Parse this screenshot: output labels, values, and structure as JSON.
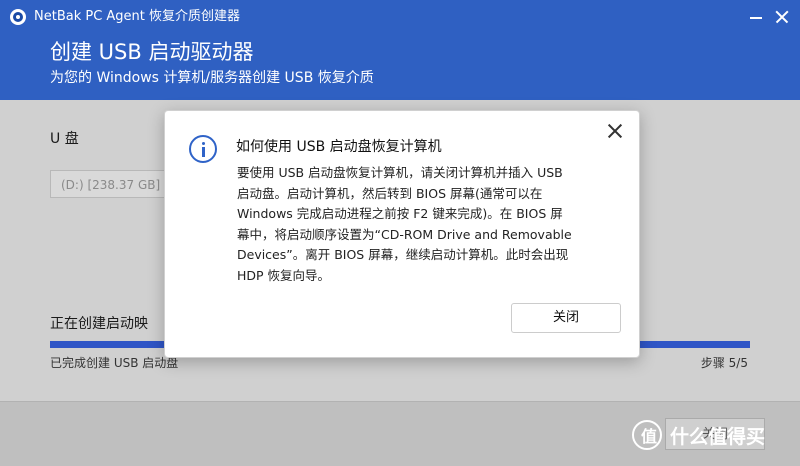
{
  "window": {
    "title": "NetBak PC Agent 恢复介质创建器",
    "heading": "创建 USB 启动驱动器",
    "subheading": "为您的 Windows 计算机/服务器创建 USB 恢复介质"
  },
  "main": {
    "drive_label": "U 盘",
    "drive_value": "(D:) [238.37 GB]",
    "progress_label": "正在创建启动映",
    "progress_fraction": 1.0,
    "status_left": "已完成创建 USB 启动盘",
    "status_right": "步骤 5/5",
    "footer_button_partial": "关闭"
  },
  "dialog": {
    "title": "如何使用 USB 启动盘恢复计算机",
    "body_lines": [
      "要使用 USB 启动盘恢复计算机，请关闭计算机并插入 USB",
      "启动盘。启动计算机，然后转到 BIOS 屏幕(通常可以在",
      "Windows 完成启动进程之前按 F2 键来完成)。在 BIOS 屏",
      "幕中，将启动顺序设置为“CD-ROM Drive and Removable",
      "Devices”。离开 BIOS 屏幕，继续启动计算机。此时会出现",
      "HDP 恢复向导。"
    ],
    "close_button": "关闭"
  },
  "watermark": {
    "glyph": "值",
    "text": "什么值得买"
  },
  "colors": {
    "header_blue": "#2f60c2",
    "progress_blue": "#2f55c6",
    "info_blue": "#2f63c8"
  }
}
